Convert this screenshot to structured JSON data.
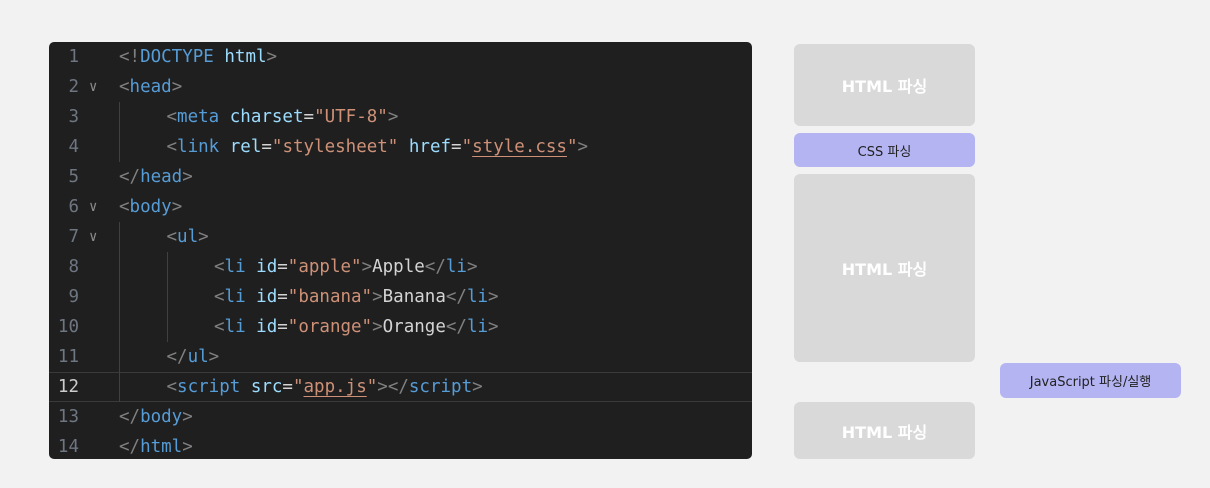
{
  "editor": {
    "lines": [
      {
        "num": "1",
        "fold": "",
        "indent": 0,
        "tokens": [
          [
            "br",
            "<!"
          ],
          [
            "tag",
            "DOCTYPE"
          ],
          [
            "txt",
            " "
          ],
          [
            "attr",
            "html"
          ],
          [
            "br",
            ">"
          ]
        ]
      },
      {
        "num": "2",
        "fold": "∨",
        "indent": 0,
        "tokens": [
          [
            "br",
            "<"
          ],
          [
            "tag",
            "head"
          ],
          [
            "br",
            ">"
          ]
        ]
      },
      {
        "num": "3",
        "fold": "",
        "indent": 1,
        "tokens": [
          [
            "br",
            "<"
          ],
          [
            "tag",
            "meta"
          ],
          [
            "txt",
            " "
          ],
          [
            "attr",
            "charset"
          ],
          [
            "txt",
            "="
          ],
          [
            "str",
            "\"UTF-8\""
          ],
          [
            "br",
            ">"
          ]
        ]
      },
      {
        "num": "4",
        "fold": "",
        "indent": 1,
        "tokens": [
          [
            "br",
            "<"
          ],
          [
            "tag",
            "link"
          ],
          [
            "txt",
            " "
          ],
          [
            "attr",
            "rel"
          ],
          [
            "txt",
            "="
          ],
          [
            "str",
            "\"stylesheet\""
          ],
          [
            "txt",
            " "
          ],
          [
            "attr",
            "href"
          ],
          [
            "txt",
            "="
          ],
          [
            "str",
            "\""
          ],
          [
            "strlink",
            "style.css"
          ],
          [
            "str",
            "\""
          ],
          [
            "br",
            ">"
          ]
        ]
      },
      {
        "num": "5",
        "fold": "",
        "indent": 0,
        "tokens": [
          [
            "br",
            "</"
          ],
          [
            "tag",
            "head"
          ],
          [
            "br",
            ">"
          ]
        ]
      },
      {
        "num": "6",
        "fold": "∨",
        "indent": 0,
        "tokens": [
          [
            "br",
            "<"
          ],
          [
            "tag",
            "body"
          ],
          [
            "br",
            ">"
          ]
        ]
      },
      {
        "num": "7",
        "fold": "∨",
        "indent": 1,
        "tokens": [
          [
            "br",
            "<"
          ],
          [
            "tag",
            "ul"
          ],
          [
            "br",
            ">"
          ]
        ]
      },
      {
        "num": "8",
        "fold": "",
        "indent": 2,
        "tokens": [
          [
            "br",
            "<"
          ],
          [
            "tag",
            "li"
          ],
          [
            "txt",
            " "
          ],
          [
            "attr",
            "id"
          ],
          [
            "txt",
            "="
          ],
          [
            "str",
            "\"apple\""
          ],
          [
            "br",
            ">"
          ],
          [
            "txt",
            "Apple"
          ],
          [
            "br",
            "</"
          ],
          [
            "tag",
            "li"
          ],
          [
            "br",
            ">"
          ]
        ]
      },
      {
        "num": "9",
        "fold": "",
        "indent": 2,
        "tokens": [
          [
            "br",
            "<"
          ],
          [
            "tag",
            "li"
          ],
          [
            "txt",
            " "
          ],
          [
            "attr",
            "id"
          ],
          [
            "txt",
            "="
          ],
          [
            "str",
            "\"banana\""
          ],
          [
            "br",
            ">"
          ],
          [
            "txt",
            "Banana"
          ],
          [
            "br",
            "</"
          ],
          [
            "tag",
            "li"
          ],
          [
            "br",
            ">"
          ]
        ]
      },
      {
        "num": "10",
        "fold": "",
        "indent": 2,
        "tokens": [
          [
            "br",
            "<"
          ],
          [
            "tag",
            "li"
          ],
          [
            "txt",
            " "
          ],
          [
            "attr",
            "id"
          ],
          [
            "txt",
            "="
          ],
          [
            "str",
            "\"orange\""
          ],
          [
            "br",
            ">"
          ],
          [
            "txt",
            "Orange"
          ],
          [
            "br",
            "</"
          ],
          [
            "tag",
            "li"
          ],
          [
            "br",
            ">"
          ]
        ]
      },
      {
        "num": "11",
        "fold": "",
        "indent": 1,
        "tokens": [
          [
            "br",
            "</"
          ],
          [
            "tag",
            "ul"
          ],
          [
            "br",
            ">"
          ]
        ]
      },
      {
        "num": "12",
        "fold": "",
        "indent": 1,
        "current": true,
        "tokens": [
          [
            "br",
            "<"
          ],
          [
            "tag",
            "script"
          ],
          [
            "txt",
            " "
          ],
          [
            "attr",
            "src"
          ],
          [
            "txt",
            "="
          ],
          [
            "str",
            "\""
          ],
          [
            "strlink",
            "app.js"
          ],
          [
            "str",
            "\""
          ],
          [
            "br",
            "></"
          ],
          [
            "tag",
            "script"
          ],
          [
            "br",
            ">"
          ]
        ]
      },
      {
        "num": "13",
        "fold": "",
        "indent": 0,
        "tokens": [
          [
            "br",
            "</"
          ],
          [
            "tag",
            "body"
          ],
          [
            "br",
            ">"
          ]
        ]
      },
      {
        "num": "14",
        "fold": "",
        "indent": 0,
        "tokens": [
          [
            "br",
            "</"
          ],
          [
            "tag",
            "html"
          ],
          [
            "br",
            ">"
          ]
        ]
      }
    ]
  },
  "timeline": {
    "html_parse_1": "HTML 파싱",
    "css_parse": "CSS 파싱",
    "html_parse_2": "HTML 파싱",
    "js_parse": "JavaScript 파싱/실행",
    "html_parse_3": "HTML 파싱"
  }
}
